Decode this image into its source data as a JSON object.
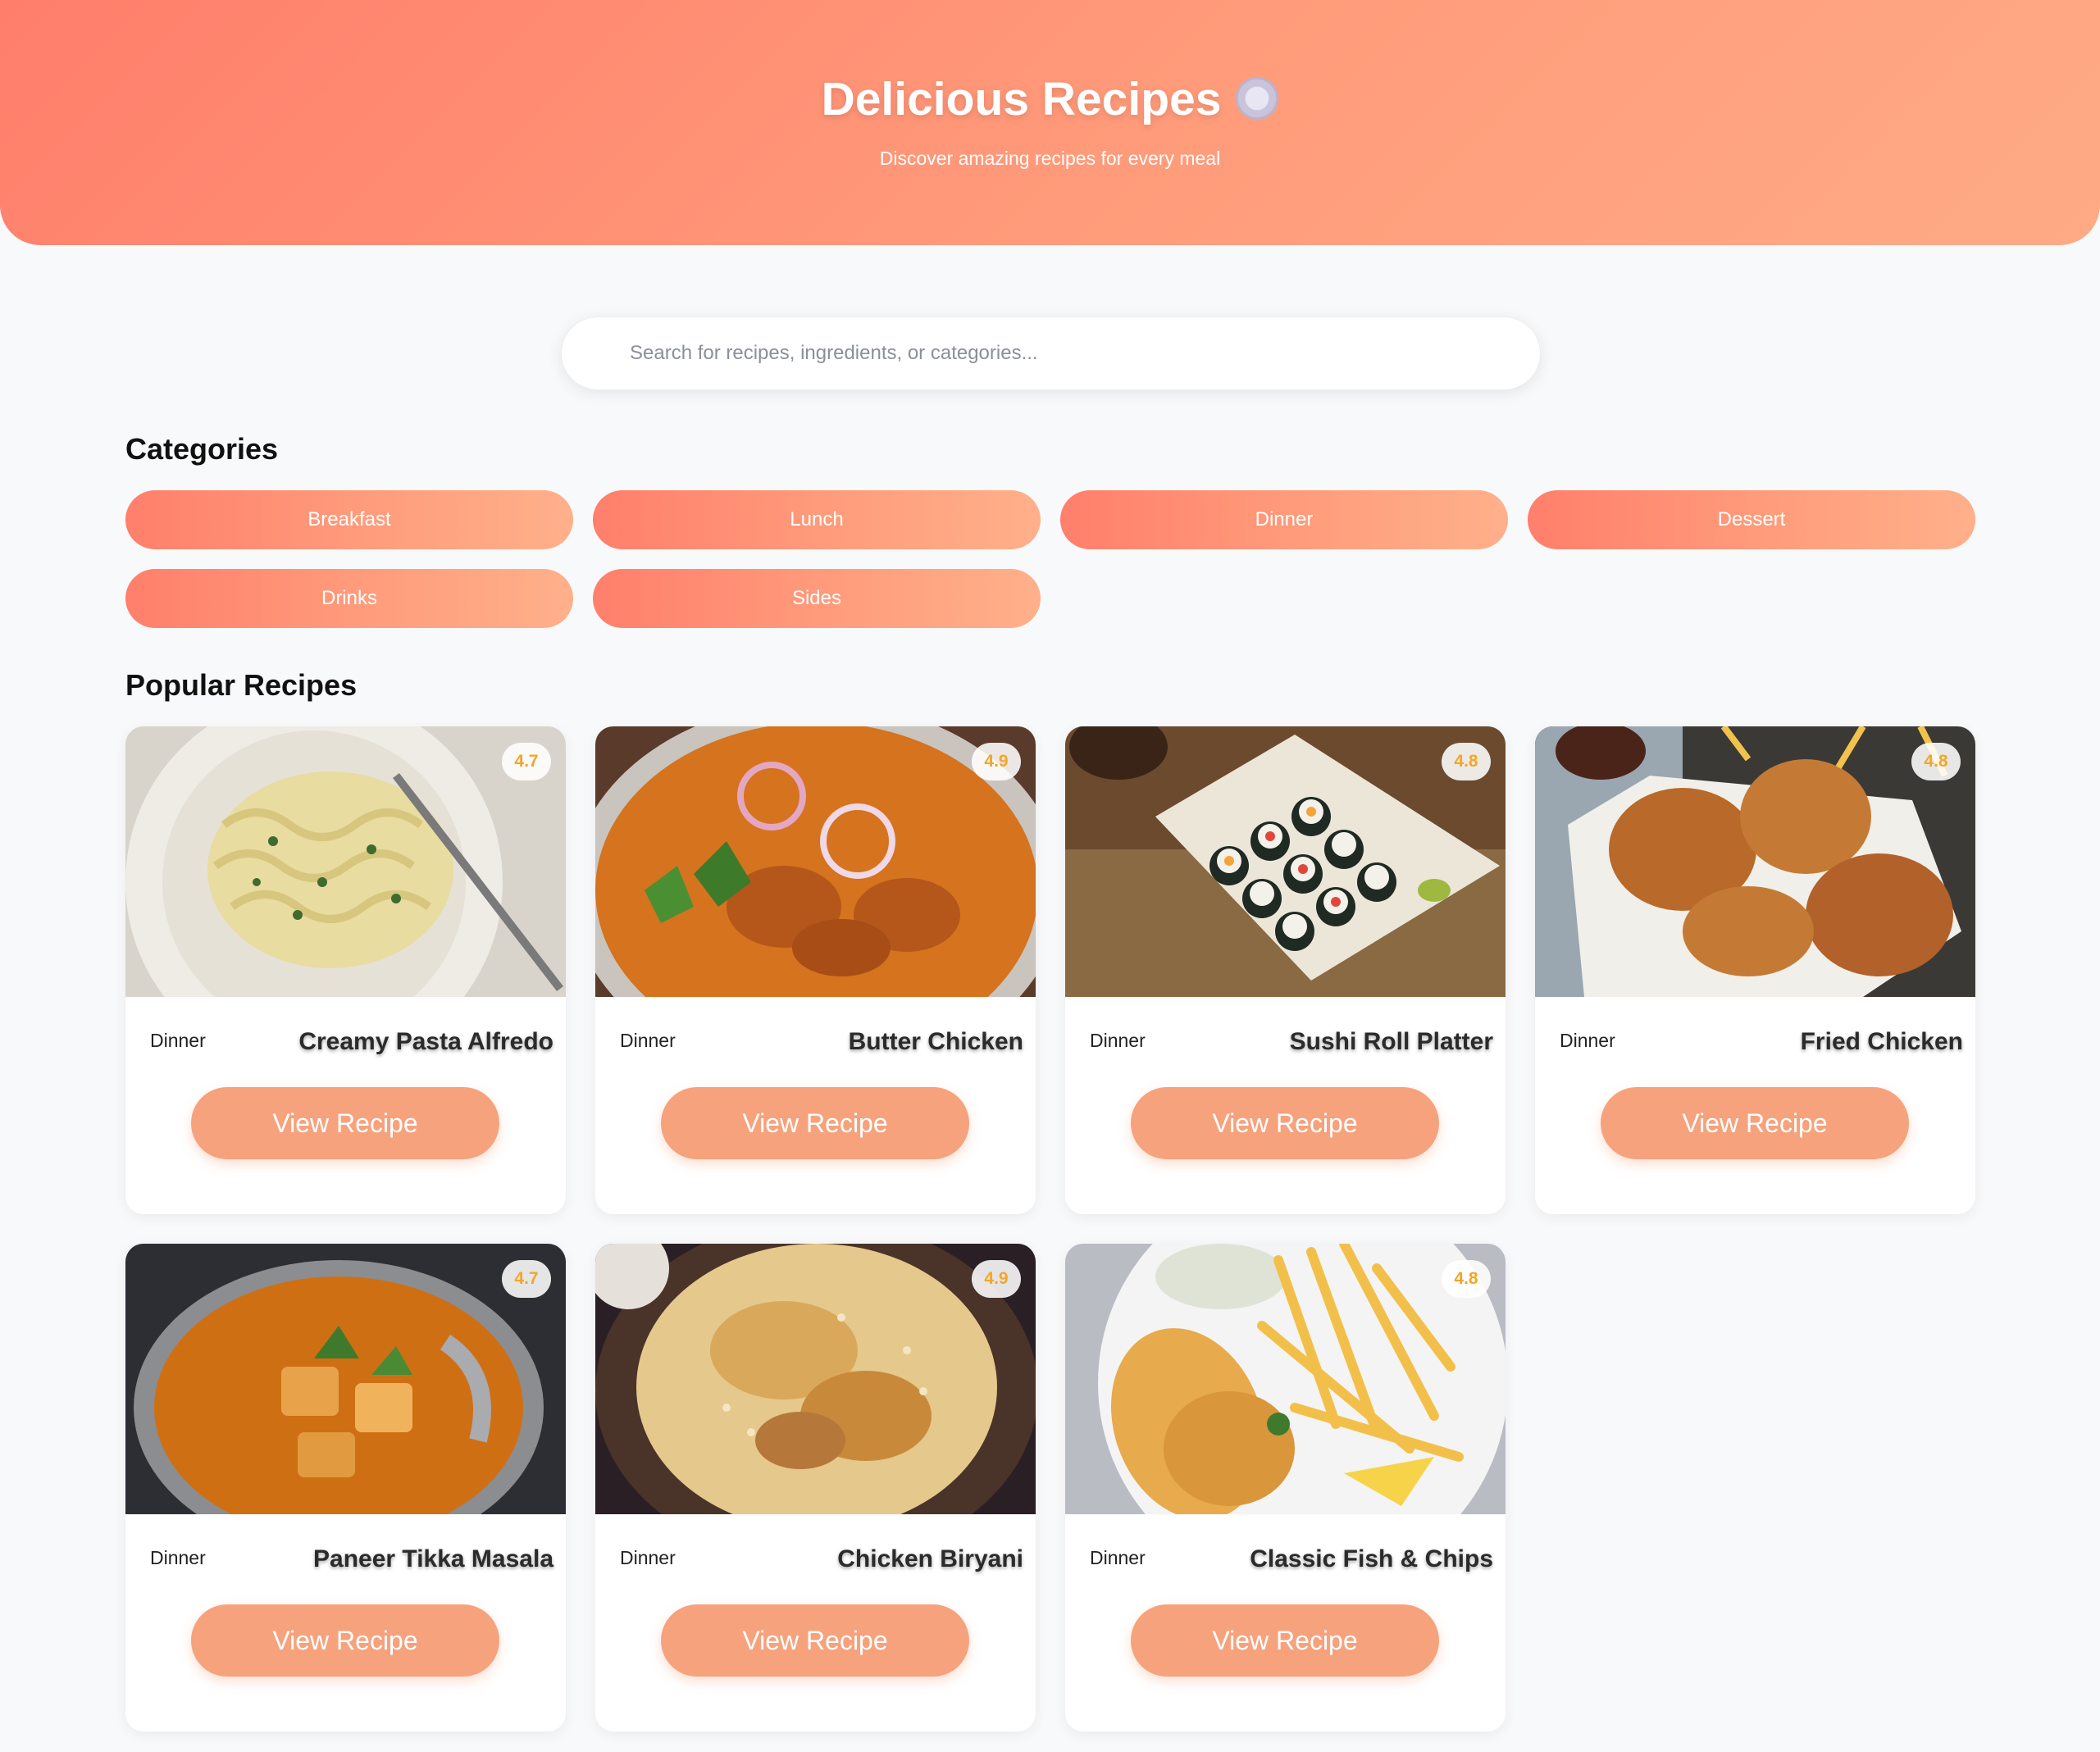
{
  "header": {
    "title": "Delicious Recipes",
    "subtitle": "Discover amazing recipes for every meal"
  },
  "search": {
    "placeholder": "Search for recipes, ingredients, or categories..."
  },
  "categories": {
    "heading": "Categories",
    "items": [
      "Breakfast",
      "Lunch",
      "Dinner",
      "Dessert",
      "Drinks",
      "Sides"
    ]
  },
  "popular": {
    "heading": "Popular Recipes",
    "button_label": "View Recipe",
    "recipes": [
      {
        "title": "Creamy Pasta Alfredo",
        "category": "Dinner",
        "rating": "4.7"
      },
      {
        "title": "Butter Chicken",
        "category": "Dinner",
        "rating": "4.9"
      },
      {
        "title": "Sushi Roll Platter",
        "category": "Dinner",
        "rating": "4.8"
      },
      {
        "title": "Fried Chicken",
        "category": "Dinner",
        "rating": "4.8"
      },
      {
        "title": "Paneer Tikka Masala",
        "category": "Dinner",
        "rating": "4.7"
      },
      {
        "title": "Chicken Biryani",
        "category": "Dinner",
        "rating": "4.9"
      },
      {
        "title": "Classic Fish & Chips",
        "category": "Dinner",
        "rating": "4.8"
      }
    ]
  },
  "colors": {
    "accent_start": "#ff7e6b",
    "accent_end": "#ffaa85",
    "button": "#f6a27c",
    "rating": "#f5a623",
    "background": "#f8f9fa"
  }
}
